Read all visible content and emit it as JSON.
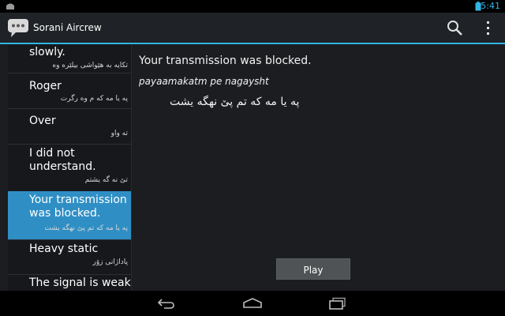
{
  "status_bar": {
    "time": "5:41",
    "accent_color": "#33b5e5"
  },
  "action_bar": {
    "title": "Sorani Aircrew",
    "icons": [
      "app-speech-bubble-icon",
      "search-icon",
      "overflow-menu-icon"
    ]
  },
  "phrases": [
    {
      "english": "slowly.",
      "kurdish": "تکایه به هێواشی بیلێره وه"
    },
    {
      "english": "Roger",
      "kurdish": "په یا مه که م وه رگرت"
    },
    {
      "english": "Over",
      "kurdish": "ته واو"
    },
    {
      "english": "I did not understand.",
      "kurdish": "تێ نه گه یشتم"
    },
    {
      "english": "Your transmission was blocked.",
      "kurdish": "په یا مه که تم پێ نهگه یشت",
      "selected": true
    },
    {
      "english": "Heavy static",
      "kurdish": "پاداژانی زۆر"
    },
    {
      "english": "The signal is weak.",
      "kurdish": ""
    }
  ],
  "detail": {
    "english": "Your transmission was blocked.",
    "transliteration": "payaamakatm pe nagaysht",
    "kurdish": "په یا مه که تم پێ نهگه یشت"
  },
  "play_button": {
    "label": "Play"
  },
  "nav_bar": {
    "icons": [
      "back-icon",
      "home-icon",
      "recent-apps-icon"
    ]
  },
  "colors": {
    "selection": "#2f8fc5",
    "background": "#1b1d20"
  }
}
